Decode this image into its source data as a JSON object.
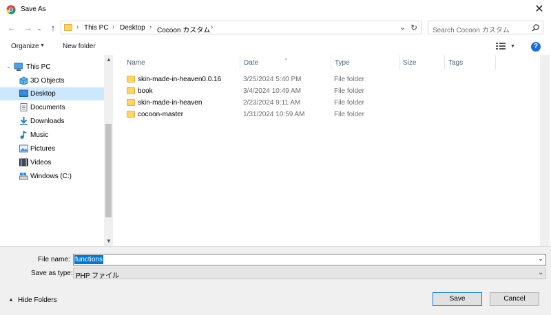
{
  "window": {
    "title": "Save As",
    "close_label": "✕"
  },
  "nav": {
    "back": "←",
    "forward": "→",
    "up": "↑",
    "breadcrumbs": [
      "This PC",
      "Desktop",
      "Cocoon カスタム"
    ],
    "refresh": "↻",
    "search_placeholder": "Search Cocoon カスタム"
  },
  "toolbar": {
    "organize": "Organize",
    "new_folder": "New folder",
    "help": "?"
  },
  "sidebar": {
    "items": [
      {
        "label": "This PC",
        "icon": "pc-icon"
      },
      {
        "label": "3D Objects",
        "icon": "cube-icon"
      },
      {
        "label": "Desktop",
        "icon": "desktop-icon",
        "selected": true
      },
      {
        "label": "Documents",
        "icon": "documents-icon"
      },
      {
        "label": "Downloads",
        "icon": "download-icon"
      },
      {
        "label": "Music",
        "icon": "music-icon"
      },
      {
        "label": "Pictures",
        "icon": "pictures-icon"
      },
      {
        "label": "Videos",
        "icon": "videos-icon"
      },
      {
        "label": "Windows (C:)",
        "icon": "drive-icon"
      }
    ]
  },
  "file_list": {
    "columns": [
      "Name",
      "Date",
      "Type",
      "Size",
      "Tags"
    ],
    "rows": [
      {
        "name": "skin-made-in-heaven0.0.16",
        "date": "3/25/2024 5:40 PM",
        "type": "File folder"
      },
      {
        "name": "book",
        "date": "3/4/2024 10:49 AM",
        "type": "File folder"
      },
      {
        "name": "skin-made-in-heaven",
        "date": "2/23/2024 9:11 AM",
        "type": "File folder"
      },
      {
        "name": "cocoon-master",
        "date": "1/31/2024 10:59 AM",
        "type": "File folder"
      }
    ]
  },
  "form": {
    "file_name_label": "File name:",
    "file_name_value": "functions",
    "save_as_type_label": "Save as type:",
    "save_as_type_value": "PHP ファイル"
  },
  "footer": {
    "hide_folders": "Hide Folders",
    "save": "Save",
    "cancel": "Cancel"
  },
  "colors": {
    "accent": "#0078d7",
    "selected_bg": "#cce8ff",
    "folder": "#ffd566"
  }
}
